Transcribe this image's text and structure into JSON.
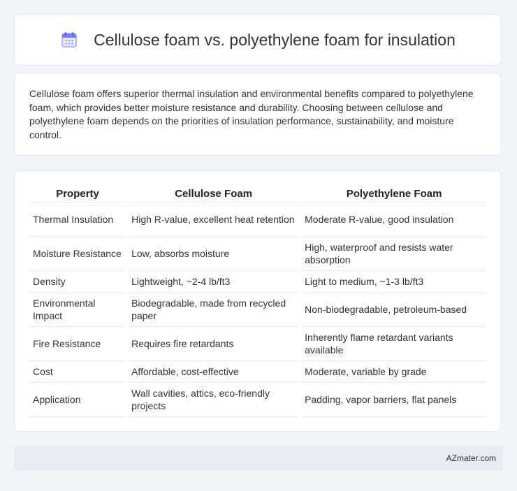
{
  "header": {
    "icon": "calendar-icon",
    "title": "Cellulose foam vs. polyethylene foam for insulation"
  },
  "intro": {
    "text": "Cellulose foam offers superior thermal insulation and environmental benefits compared to polyethylene foam, which provides better moisture resistance and durability. Choosing between cellulose and polyethylene foam depends on the priorities of insulation performance, sustainability, and moisture control."
  },
  "table": {
    "headers": [
      "Property",
      "Cellulose Foam",
      "Polyethylene Foam"
    ],
    "rows": [
      [
        "Thermal Insulation",
        "High R-value, excellent heat retention",
        "Moderate R-value, good insulation"
      ],
      [
        "Moisture Resistance",
        "Low, absorbs moisture",
        "High, waterproof and resists water absorption"
      ],
      [
        "Density",
        "Lightweight, ~2-4 lb/ft3",
        "Light to medium, ~1-3 lb/ft3"
      ],
      [
        "Environmental Impact",
        "Biodegradable, made from recycled paper",
        "Non-biodegradable, petroleum-based"
      ],
      [
        "Fire Resistance",
        "Requires fire retardants",
        "Inherently flame retardant variants available"
      ],
      [
        "Cost",
        "Affordable, cost-effective",
        "Moderate, variable by grade"
      ],
      [
        "Application",
        "Wall cavities, attics, eco-friendly projects",
        "Padding, vapor barriers, flat panels"
      ]
    ]
  },
  "footer": {
    "brand": "AZmater.com"
  },
  "colors": {
    "background": "#f1f4f9",
    "card": "#ffffff",
    "footer": "#e6ebf4",
    "icon_accent": "#7a7ff0"
  }
}
